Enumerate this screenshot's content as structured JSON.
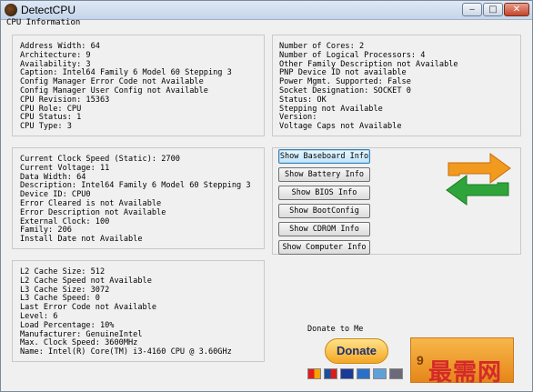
{
  "window": {
    "title": "DetectCPU"
  },
  "section_label": "CPU Information",
  "panels": {
    "general": [
      "Address Width: 64",
      "Architecture: 9",
      "Availability: 3",
      "Caption: Intel64 Family 6 Model 60 Stepping 3",
      "Config Manager Error Code not Available",
      "Config Manager User Config not Available",
      "CPU Revision: 15363",
      "CPU Role: CPU",
      "CPU Status: 1",
      "CPU Type: 3"
    ],
    "cores": [
      "Number of Cores: 2",
      "Number of Logical Processors: 4",
      "Other Family Description not Available",
      "PNP Device ID not available",
      "Power Mgmt. Supported: False",
      "Socket Designation: SOCKET 0",
      "Status: OK",
      "Stepping not Available",
      "Version:",
      "Voltage Caps not Available"
    ],
    "clock": [
      "Current Clock Speed (Static): 2700",
      "Current Voltage: 11",
      "Data Width: 64",
      "Description: Intel64 Family 6 Model 60 Stepping 3",
      "Device ID: CPU0",
      "Error Cleared is not Available",
      "Error Description not Available",
      "External Clock: 100",
      "Family: 206",
      "Install Date not Available"
    ],
    "cache": [
      "L2 Cache Size: 512",
      "L2 Cache Speed not Available",
      "L3 Cache Size: 3072",
      "L3 Cache Speed: 0",
      "Last Error Code not Available",
      "Level: 6",
      "Load Percentage: 10%",
      "Manufacturer: GenuineIntel",
      "Max. Clock Speed: 3600MHz",
      "Name: Intel(R) Core(TM) i3-4160 CPU @ 3.60GHz"
    ]
  },
  "buttons": [
    "Show Baseboard Info",
    "Show Battery Info",
    "Show BIOS Info",
    "Show BootConfig",
    "Show CDROM Info",
    "Show Computer Info"
  ],
  "donate": {
    "label": "Donate to Me",
    "button": "Donate",
    "cards": [
      "mastercard-icon",
      "maestro-icon",
      "visa-icon",
      "visa-electron-icon",
      "amex-icon",
      "bank-icon"
    ],
    "orange_box_text": "9"
  },
  "icons": {
    "app": "cpu-app-icon",
    "refresh": "refresh-arrows-icon"
  },
  "colors": {
    "arrow_orange": "#f29a1f",
    "arrow_green": "#2fa43a",
    "watermark": "#d42a2a"
  },
  "watermark": "最需网"
}
